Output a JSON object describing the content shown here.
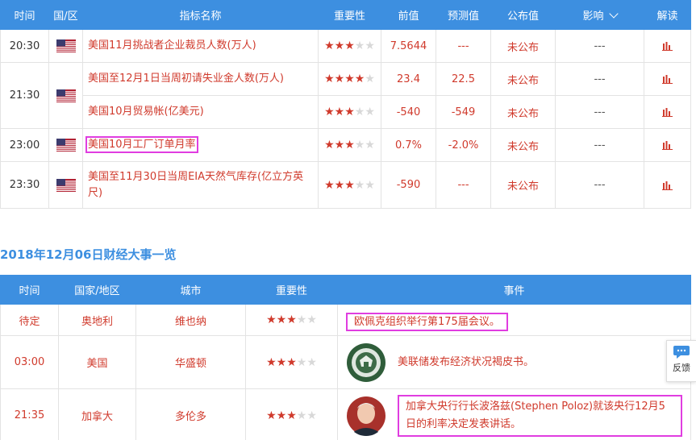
{
  "top_table": {
    "headers": [
      "时间",
      "国/区",
      "指标名称",
      "重要性",
      "前值",
      "预测值",
      "公布值",
      "影响",
      "解读"
    ],
    "rows": [
      {
        "time": "20:30",
        "indicator": "美国11月挑战者企业裁员人数(万人)",
        "stars": 3,
        "prev": "7.5644",
        "forecast": "---",
        "published": "未公布",
        "impact": "---"
      },
      {
        "time": "21:30",
        "indicator": "美国至12月1日当周初请失业金人数(万人)",
        "stars": 4,
        "prev": "23.4",
        "forecast": "22.5",
        "published": "未公布",
        "impact": "---"
      },
      {
        "time": "",
        "indicator": "美国10月贸易帐(亿美元)",
        "stars": 3,
        "prev": "-540",
        "forecast": "-549",
        "published": "未公布",
        "impact": "---"
      },
      {
        "time": "23:00",
        "indicator": "美国10月工厂订单月率",
        "stars": 3,
        "prev": "0.7%",
        "forecast": "-2.0%",
        "published": "未公布",
        "impact": "---"
      },
      {
        "time": "23:30",
        "indicator": "美国至11月30日当周EIA天然气库存(亿立方英尺)",
        "stars": 3,
        "prev": "-590",
        "forecast": "---",
        "published": "未公布",
        "impact": "---"
      }
    ]
  },
  "section_title": "2018年12月06日财经大事一览",
  "bottom_table": {
    "headers": [
      "时间",
      "国家/地区",
      "城市",
      "重要性",
      "事件"
    ],
    "rows": [
      {
        "time": "待定",
        "country": "奥地利",
        "city": "维也纳",
        "stars": 3,
        "event": "欧佩克组织举行第175届会议。"
      },
      {
        "time": "03:00",
        "country": "美国",
        "city": "华盛顿",
        "stars": 3,
        "event": "美联储发布经济状况褐皮书。"
      },
      {
        "time": "21:35",
        "country": "加拿大",
        "city": "多伦多",
        "stars": 3,
        "event": "加拿大央行行长波洛兹(Stephen Poloz)就该央行12月5日的利率决定发表讲话。"
      }
    ]
  },
  "feedback_label": "反馈",
  "colors": {
    "header_blue": "#3d8fe0",
    "text_red": "#d03a2c",
    "highlight_magenta": "#e03de0"
  }
}
